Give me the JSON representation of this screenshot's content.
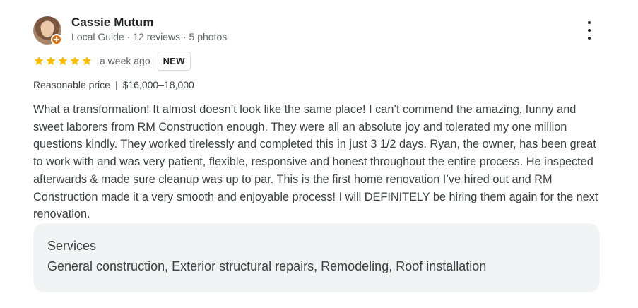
{
  "reviewer": {
    "name": "Cassie Mutum",
    "meta": "Local Guide · 12 reviews · 5 photos",
    "avatar_icon": "avatar-photo",
    "badge_icon": "local-guide-badge-icon",
    "badge_color": "#e8710a"
  },
  "menu_icon": "more-vert-icon",
  "rating": {
    "stars": 5,
    "max_stars": 5,
    "star_color": "#fbbc04",
    "time": "a week ago",
    "badge": "NEW"
  },
  "price": {
    "label": "Reasonable price",
    "separator": "|",
    "value": "$16,000–18,000"
  },
  "review_text": "What a transformation! It almost doesn’t look like the same place! I can’t commend the amazing, funny and sweet laborers from RM Construction enough. They were all an absolute joy and tolerated my one million questions kindly. They worked tirelessly and completed this in just 3 1/2 days. Ryan, the owner, has been great to work with and was very patient, flexible, responsive and honest throughout the entire process. He inspected afterwards & made sure cleanup was up to par. This is the first home renovation I’ve hired out and RM Construction made it a very smooth and enjoyable process! I will DEFINITELY be hiring them again for the next renovation.",
  "services": {
    "title": "Services",
    "list": "General construction, Exterior structural repairs, Remodeling, Roof installation"
  }
}
